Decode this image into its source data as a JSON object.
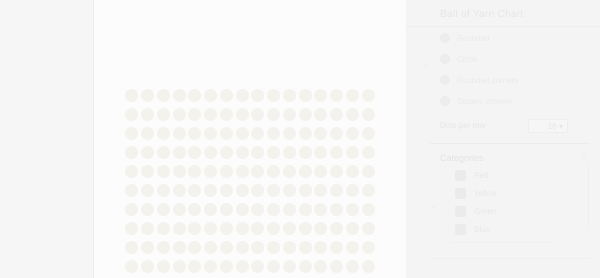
{
  "colors": {
    "page_background": "#f7f7f7",
    "canvas_background": "#fcfcfc",
    "dot": "#f4f2ec",
    "panel_background": "#f4f4f4"
  },
  "panel": {
    "title": "Ball of Yarn Chart",
    "options": [
      {
        "label": "Rounded",
        "icon": "circle-icon"
      },
      {
        "label": "Circle",
        "icon": "circle-icon"
      },
      {
        "label": "Rounded corners",
        "icon": "square-icon"
      },
      {
        "label": "Square corners",
        "icon": "square-icon"
      }
    ],
    "side_mark": "<",
    "dots_label": "Dots per row",
    "dots_value": "16 ▾",
    "categories": {
      "heading": "Categories",
      "chevron": "^",
      "mark": "<",
      "items": [
        {
          "label": "Red"
        },
        {
          "label": "Yellow"
        },
        {
          "label": "Green"
        },
        {
          "label": "Blue"
        }
      ]
    }
  }
}
